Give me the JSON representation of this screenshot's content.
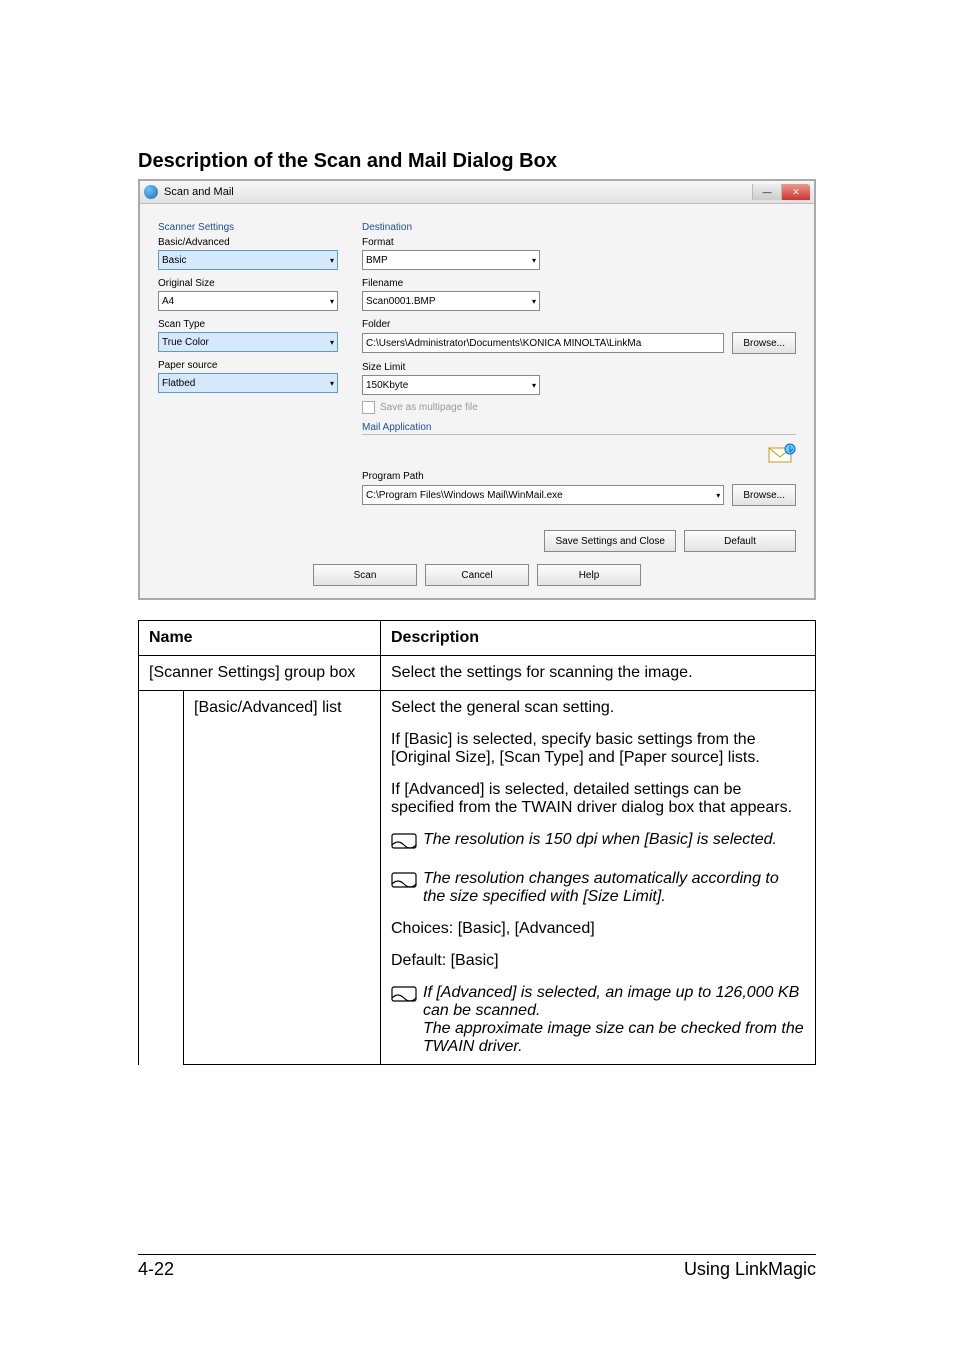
{
  "heading": "Description of the Scan and Mail Dialog Box",
  "dialog": {
    "title": "Scan and Mail",
    "left": {
      "scanner_settings": "Scanner Settings",
      "basic_advanced_label": "Basic/Advanced",
      "basic_advanced_value": "Basic",
      "original_size_label": "Original Size",
      "original_size_value": "A4",
      "scan_type_label": "Scan Type",
      "scan_type_value": "True Color",
      "paper_source_label": "Paper source",
      "paper_source_value": "Flatbed"
    },
    "right": {
      "destination": "Destination",
      "format_label": "Format",
      "format_value": "BMP",
      "filename_label": "Filename",
      "filename_value": "Scan0001.BMP",
      "folder_label": "Folder",
      "folder_value": "C:\\Users\\Administrator\\Documents\\KONICA MINOLTA\\LinkMa",
      "size_limit_label": "Size Limit",
      "size_limit_value": "150Kbyte",
      "multipage_label": "Save as multipage file",
      "mail_app": "Mail Application",
      "program_path_label": "Program Path",
      "program_path_value": "C:\\Program Files\\Windows Mail\\WinMail.exe"
    },
    "buttons": {
      "browse": "Browse...",
      "save_close": "Save Settings and Close",
      "default": "Default",
      "scan": "Scan",
      "cancel": "Cancel",
      "help": "Help"
    }
  },
  "table": {
    "h_name": "Name",
    "h_desc": "Description",
    "r1_name": "[Scanner Settings] group box",
    "r1_desc": "Select the settings for scanning the image.",
    "r2_name": "[Basic/Advanced] list",
    "r2_d1": "Select the general scan setting.",
    "r2_d2": "If [Basic] is selected, specify basic settings from the [Original Size], [Scan Type] and [Paper source] lists.",
    "r2_d3": "If [Advanced] is selected, detailed settings can be specified from the TWAIN driver dialog box that appears.",
    "r2_n1": "The resolution is 150 dpi when [Basic] is selected.",
    "r2_n2": "The resolution changes automatically according to the size specified with [Size Limit].",
    "r2_d4": "Choices: [Basic], [Advanced]",
    "r2_d5": "Default: [Basic]",
    "r2_n3": "If [Advanced] is selected, an image up to 126,000 KB can be scanned.\nThe approximate image size can be checked from the TWAIN driver."
  },
  "footer": {
    "left": "4-22",
    "right": "Using LinkMagic"
  }
}
